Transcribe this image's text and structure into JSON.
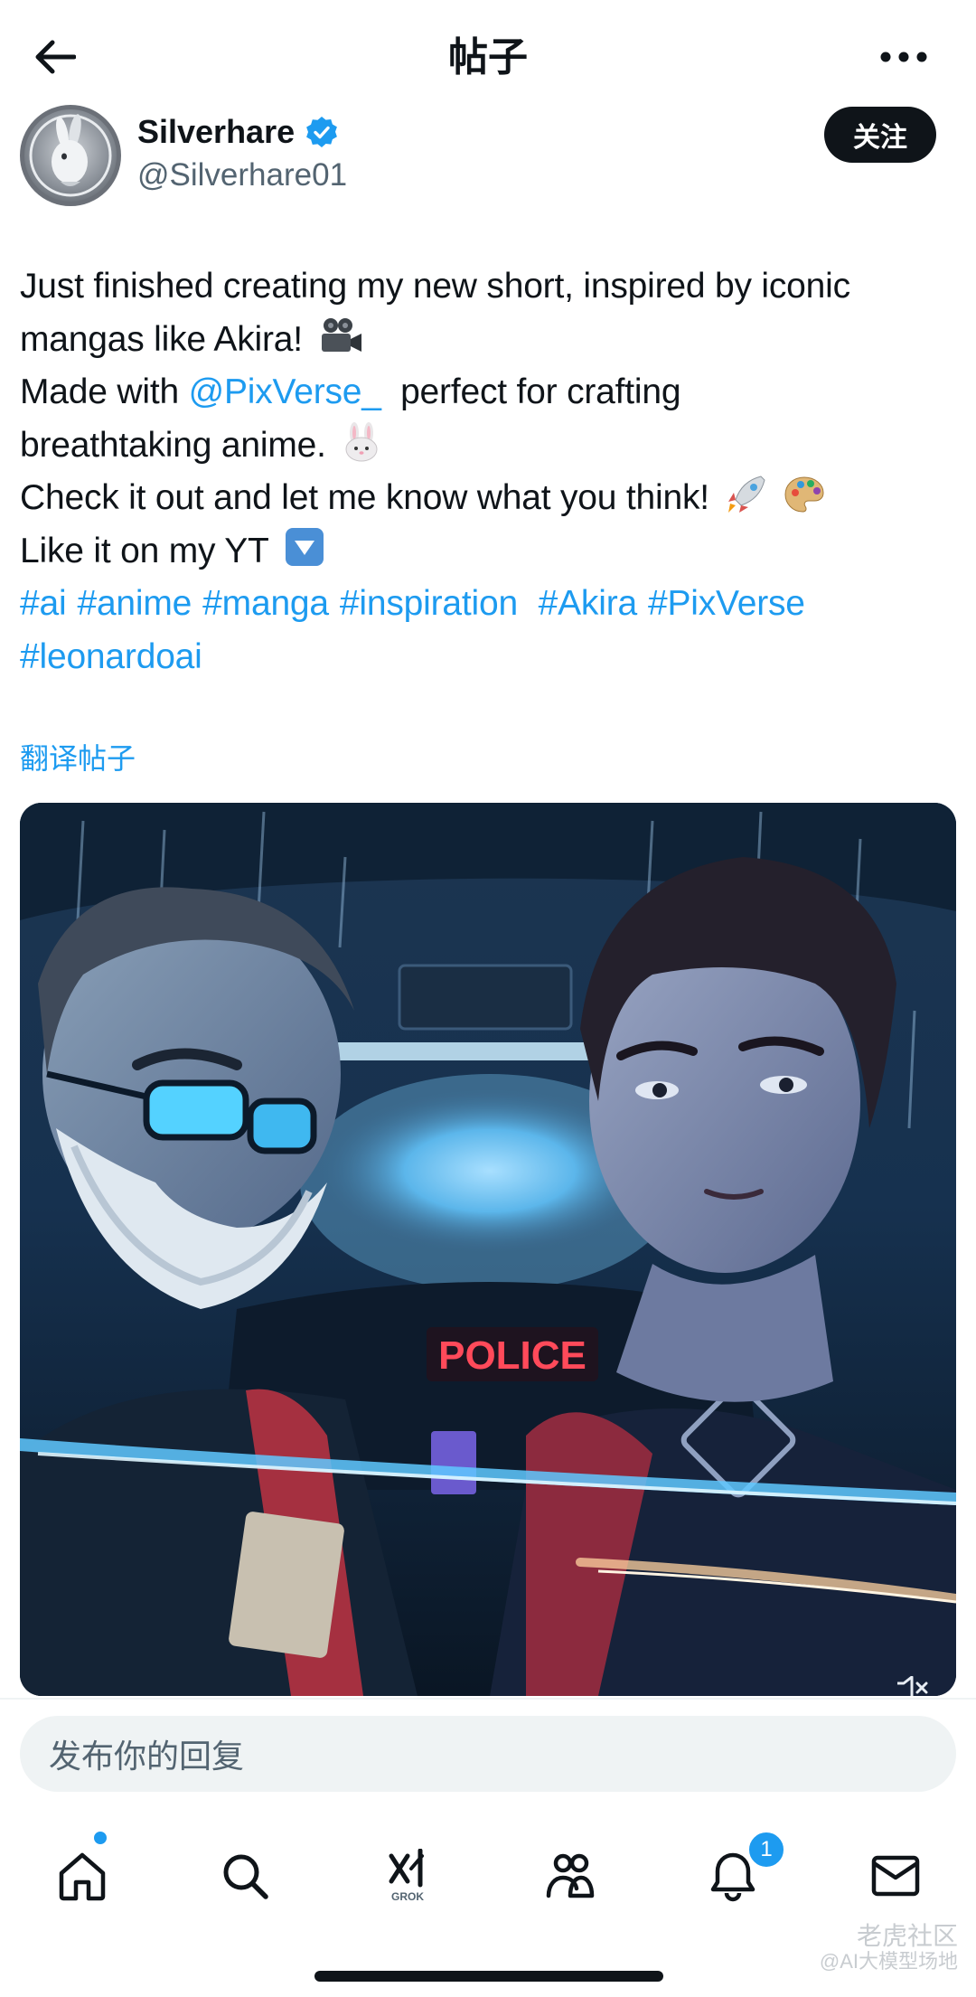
{
  "header": {
    "title": "帖子",
    "back_icon": "arrow-left-icon",
    "more_icon": "more-horizontal-icon"
  },
  "author": {
    "display_name": "Silverhare",
    "handle": "@Silverhare01",
    "verified": true,
    "verified_color": "#1d9bf0",
    "follow_label": "关注"
  },
  "post": {
    "line1": "Just finished creating my new short, inspired by iconic",
    "line2": "mangas like Akira!",
    "line3_prefix": "Made with",
    "mention": "@PixVerse_",
    "line3_suffix": "perfect for crafting",
    "line4": "breathtaking anime.",
    "line5": "Check it out and let me know what you think!",
    "line6": "Like it on my YT",
    "hashtags": [
      "#ai",
      "#anime",
      "#manga",
      "#inspiration",
      "#Akira",
      "#PixVerse",
      "#leonardoai"
    ],
    "translate_label": "翻译帖子",
    "emojis": [
      "video-camera-emoji",
      "rabbit-emoji",
      "rocket-emoji",
      "palette-emoji",
      "down-arrow-emoji"
    ]
  },
  "media": {
    "sign_text": "POLICE",
    "mute_icon": "muted-speaker-icon"
  },
  "reply": {
    "placeholder": "发布你的回复"
  },
  "nav": {
    "items": [
      {
        "name": "home",
        "icon": "home-icon"
      },
      {
        "name": "search",
        "icon": "search-icon"
      },
      {
        "name": "grok",
        "icon": "grok-icon",
        "label": "GROK"
      },
      {
        "name": "communities",
        "icon": "people-icon"
      },
      {
        "name": "notifications",
        "icon": "bell-icon",
        "badge": "1"
      },
      {
        "name": "messages",
        "icon": "mail-icon"
      }
    ]
  },
  "watermark": {
    "line1": "老虎社区",
    "line2": "@AI大模型场地"
  },
  "colors": {
    "accent": "#1d9bf0",
    "text": "#0f1419",
    "secondary": "#536471"
  }
}
